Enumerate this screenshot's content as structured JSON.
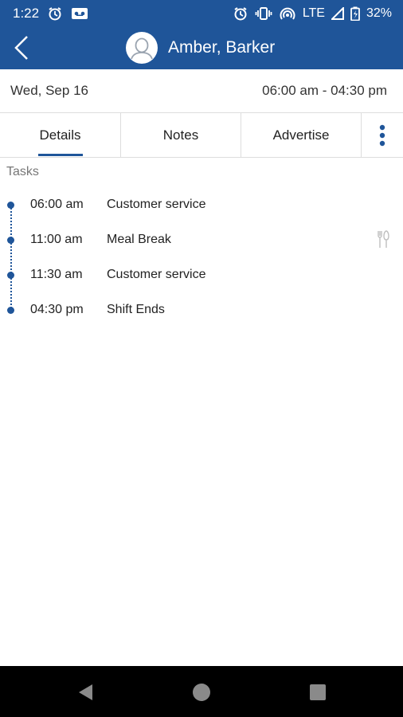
{
  "status_bar": {
    "time": "1:22",
    "battery": "32%",
    "network": "LTE",
    "left_icons": [
      "alarm-icon",
      "voicemail-icon"
    ],
    "right_icons": [
      "alarm-icon",
      "vibrate-icon",
      "hotspot-icon",
      "signal-icon",
      "battery-icon"
    ]
  },
  "header": {
    "title": "Amber, Barker",
    "back_icon": "back-icon",
    "avatar_icon": "user-avatar-icon"
  },
  "shift": {
    "date": "Wed, Sep 16",
    "time_range": "06:00 am - 04:30 pm"
  },
  "tabs": [
    {
      "label": "Details",
      "active": true
    },
    {
      "label": "Notes",
      "active": false
    },
    {
      "label": "Advertise",
      "active": false
    }
  ],
  "tasks": {
    "section_title": "Tasks",
    "items": [
      {
        "time": "06:00 am",
        "name": "Customer service"
      },
      {
        "time": "11:00 am",
        "name": "Meal Break",
        "icon": "fork-knife-icon"
      },
      {
        "time": "11:30 am",
        "name": "Customer service"
      },
      {
        "time": "04:30 pm",
        "name": "Shift Ends"
      }
    ]
  },
  "colors": {
    "primary": "#1f5599",
    "navbar": "#000000",
    "text": "#222222",
    "muted": "#777777"
  },
  "nav_bar": {
    "buttons": [
      "back-triangle-icon",
      "home-circle-icon",
      "recents-square-icon"
    ]
  }
}
